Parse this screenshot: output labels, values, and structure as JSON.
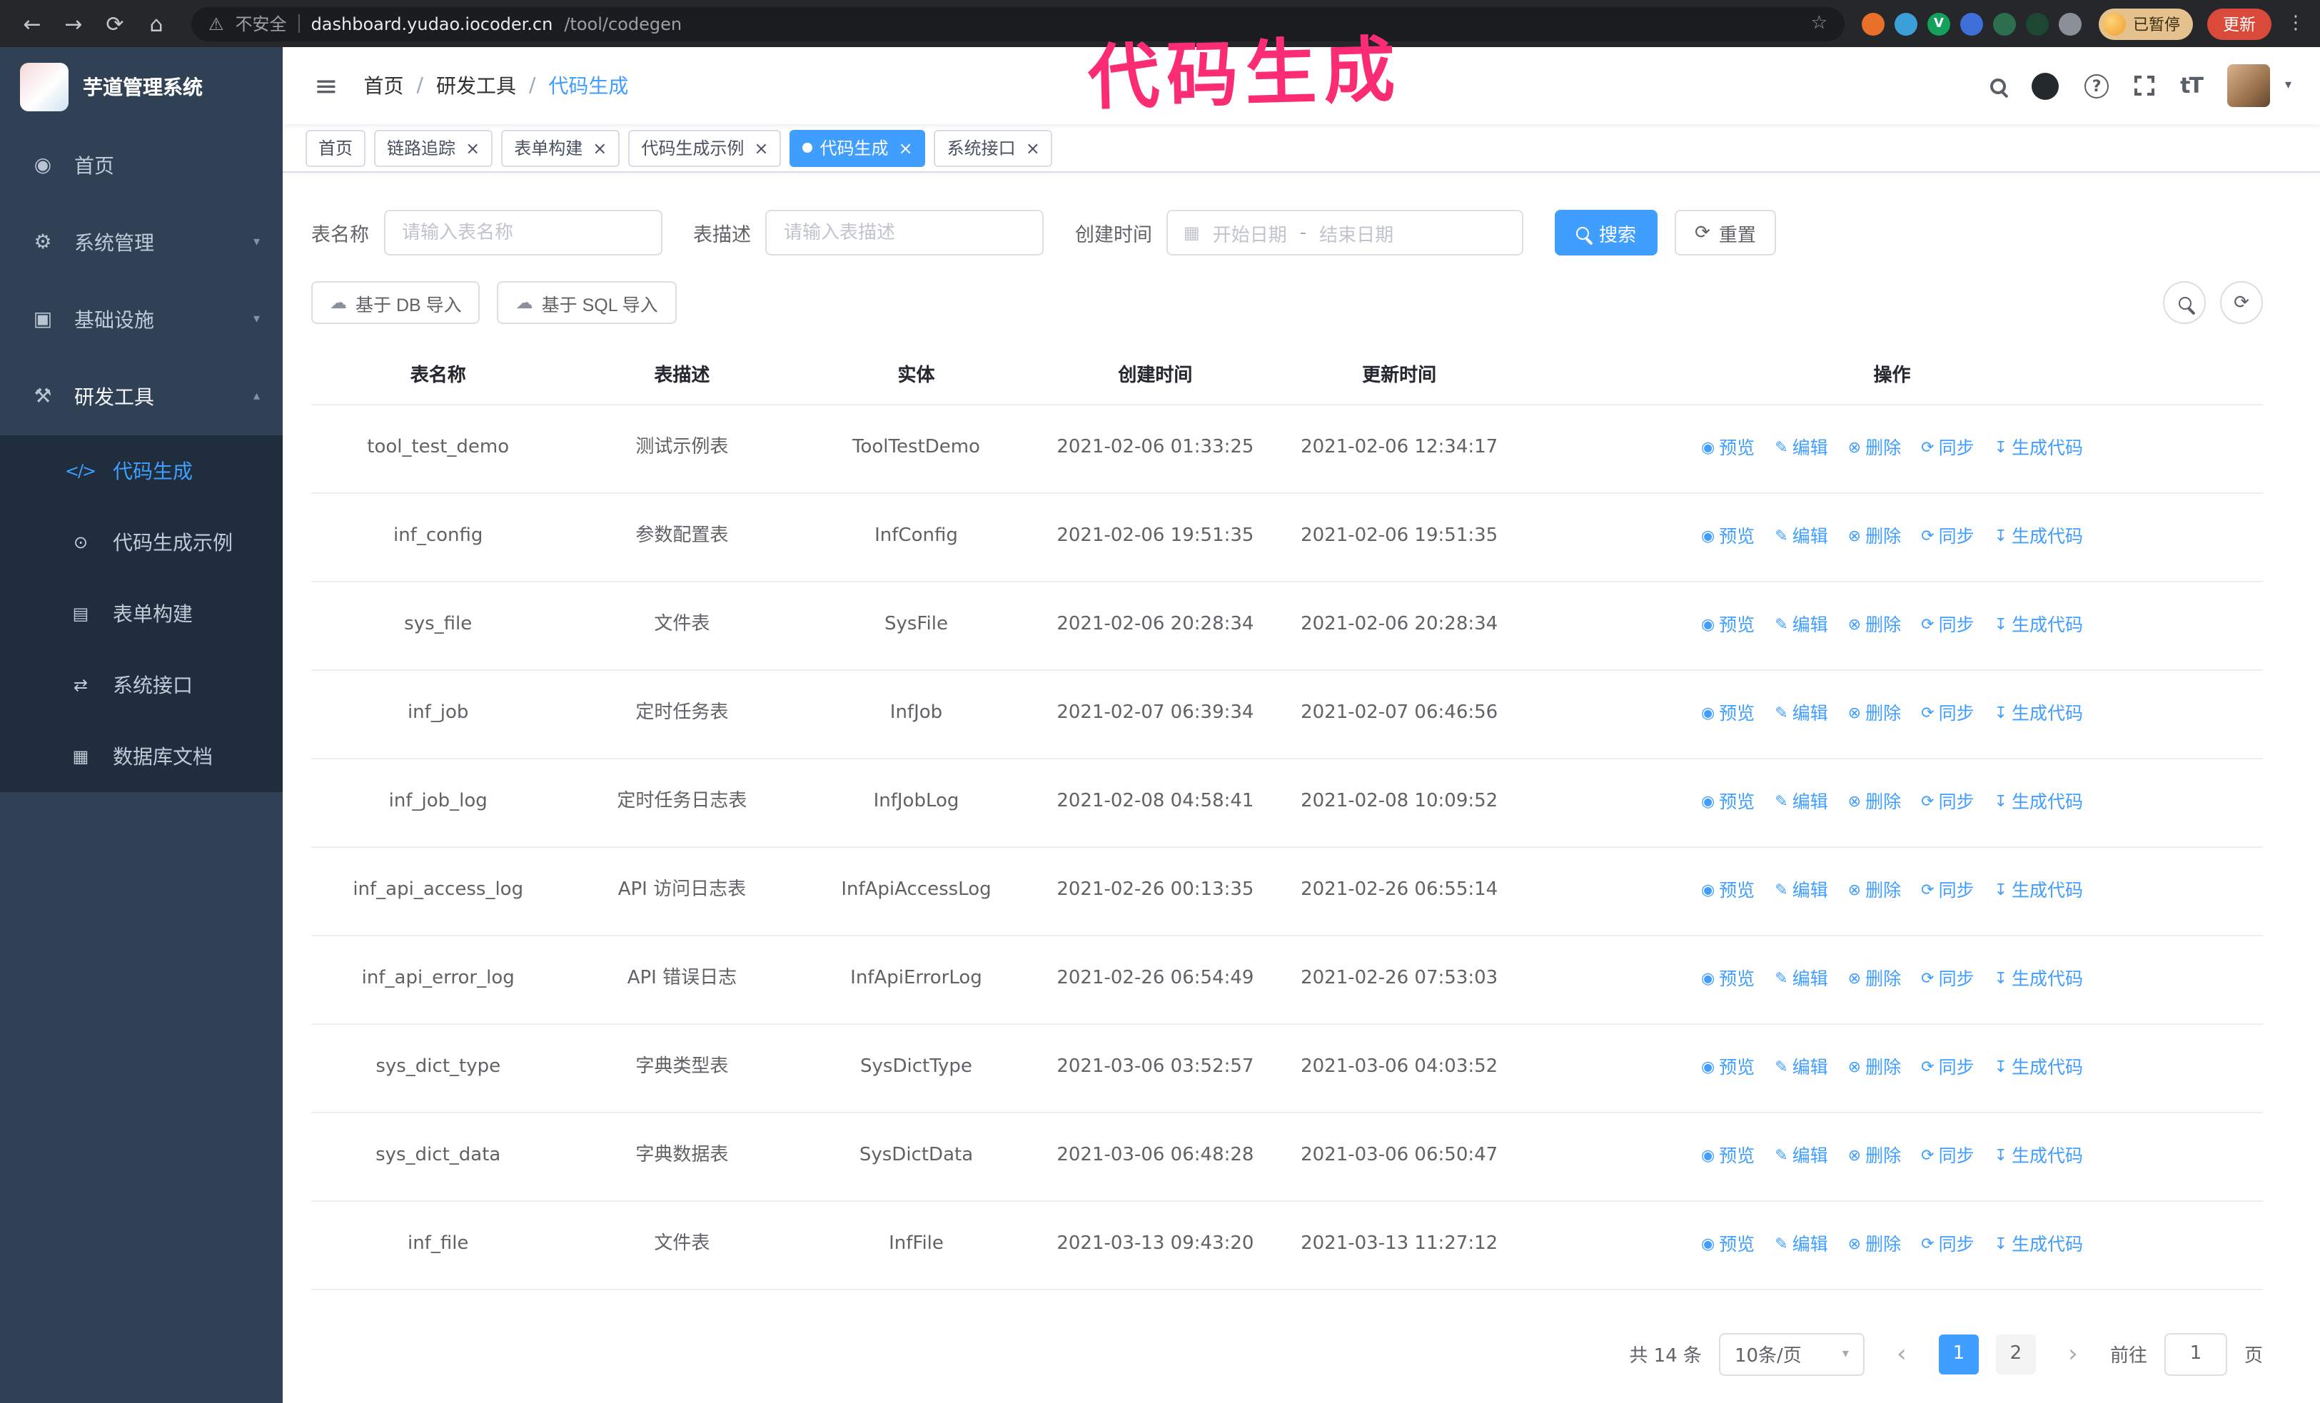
{
  "browser": {
    "security_label": "不安全",
    "url_host": "dashboard.yudao.iocoder.cn",
    "url_path": "/tool/codegen",
    "profile_badge": "已暂停",
    "update_label": "更新",
    "extensions": [
      {
        "name": "extension-icon-orange",
        "color": "#e8702a",
        "glyph": ""
      },
      {
        "name": "extension-icon-lightblue",
        "color": "#3d9fd8",
        "glyph": ""
      },
      {
        "name": "extension-icon-green-v",
        "color": "#16a05d",
        "glyph": "V"
      },
      {
        "name": "extension-icon-blue",
        "color": "#3f6fd8",
        "glyph": ""
      },
      {
        "name": "extension-icon-teal",
        "color": "#2d6e4f",
        "glyph": ""
      },
      {
        "name": "extension-icon-darkgreen",
        "color": "#1d4633",
        "glyph": ""
      },
      {
        "name": "extension-icon-puzzle",
        "color": "#8a8f98",
        "glyph": ""
      }
    ]
  },
  "annotation": {
    "text": "代码生成",
    "color": "#fb2b74"
  },
  "sidebar": {
    "logo_title": "芋道管理系统",
    "menu": [
      {
        "label": "首页"
      },
      {
        "label": "系统管理"
      },
      {
        "label": "基础设施"
      },
      {
        "label": "研发工具"
      }
    ],
    "submenu": [
      {
        "label": "代码生成"
      },
      {
        "label": "代码生成示例"
      },
      {
        "label": "表单构建"
      },
      {
        "label": "系统接口"
      },
      {
        "label": "数据库文档"
      }
    ]
  },
  "breadcrumb": {
    "items": [
      "首页",
      "研发工具",
      "代码生成"
    ],
    "separator": "/"
  },
  "tabs": [
    {
      "label": "首页",
      "closable": false,
      "active": false
    },
    {
      "label": "链路追踪",
      "closable": true,
      "active": false
    },
    {
      "label": "表单构建",
      "closable": true,
      "active": false
    },
    {
      "label": "代码生成示例",
      "closable": true,
      "active": false
    },
    {
      "label": "代码生成",
      "closable": true,
      "active": true
    },
    {
      "label": "系统接口",
      "closable": true,
      "active": false
    }
  ],
  "filters": {
    "table_name_label": "表名称",
    "table_name_placeholder": "请输入表名称",
    "table_desc_label": "表描述",
    "table_desc_placeholder": "请输入表描述",
    "create_time_label": "创建时间",
    "start_placeholder": "开始日期",
    "range_separator": "-",
    "end_placeholder": "结束日期",
    "search_label": "搜索",
    "reset_label": "重置"
  },
  "toolbar": {
    "import_db_label": "基于 DB 导入",
    "import_sql_label": "基于 SQL 导入"
  },
  "table": {
    "columns": [
      "表名称",
      "表描述",
      "实体",
      "创建时间",
      "更新时间",
      "操作"
    ],
    "rows": [
      {
        "name": "tool_test_demo",
        "desc": "测试示例表",
        "entity": "ToolTestDemo",
        "created": "2021-02-06 01:33:25",
        "updated": "2021-02-06 12:34:17"
      },
      {
        "name": "inf_config",
        "desc": "参数配置表",
        "entity": "InfConfig",
        "created": "2021-02-06 19:51:35",
        "updated": "2021-02-06 19:51:35"
      },
      {
        "name": "sys_file",
        "desc": "文件表",
        "entity": "SysFile",
        "created": "2021-02-06 20:28:34",
        "updated": "2021-02-06 20:28:34"
      },
      {
        "name": "inf_job",
        "desc": "定时任务表",
        "entity": "InfJob",
        "created": "2021-02-07 06:39:34",
        "updated": "2021-02-07 06:46:56"
      },
      {
        "name": "inf_job_log",
        "desc": "定时任务日志表",
        "entity": "InfJobLog",
        "created": "2021-02-08 04:58:41",
        "updated": "2021-02-08 10:09:52"
      },
      {
        "name": "inf_api_access_log",
        "desc": "API 访问日志表",
        "entity": "InfApiAccessLog",
        "created": "2021-02-26 00:13:35",
        "updated": "2021-02-26 06:55:14"
      },
      {
        "name": "inf_api_error_log",
        "desc": "API 错误日志",
        "entity": "InfApiErrorLog",
        "created": "2021-02-26 06:54:49",
        "updated": "2021-02-26 07:53:03"
      },
      {
        "name": "sys_dict_type",
        "desc": "字典类型表",
        "entity": "SysDictType",
        "created": "2021-03-06 03:52:57",
        "updated": "2021-03-06 04:03:52"
      },
      {
        "name": "sys_dict_data",
        "desc": "字典数据表",
        "entity": "SysDictData",
        "created": "2021-03-06 06:48:28",
        "updated": "2021-03-06 06:50:47"
      },
      {
        "name": "inf_file",
        "desc": "文件表",
        "entity": "InfFile",
        "created": "2021-03-13 09:43:20",
        "updated": "2021-03-13 11:27:12"
      }
    ],
    "actions": [
      {
        "key": "preview",
        "label": "预览",
        "icon": "◉"
      },
      {
        "key": "edit",
        "label": "编辑",
        "icon": "✎"
      },
      {
        "key": "delete",
        "label": "删除",
        "icon": "⊗"
      },
      {
        "key": "sync",
        "label": "同步",
        "icon": "⟳"
      },
      {
        "key": "generate",
        "label": "生成代码",
        "icon": "↧"
      }
    ]
  },
  "pagination": {
    "total_text": "共 14 条",
    "page_size_text": "10条/页",
    "pages": [
      "1",
      "2"
    ],
    "active_page": "1",
    "goto_label": "前往",
    "goto_value": "1",
    "goto_suffix": "页"
  },
  "colors": {
    "accent": "#409eff",
    "sidebar_bg": "#304156",
    "submenu_bg": "#1f2d3d",
    "update_button_bg": "#d94a3a",
    "profile_chip_bg": "#e5c28d"
  },
  "icons": {
    "back": "←",
    "forward": "→",
    "reload": "⟳",
    "home": "⌂",
    "warning": "⚠",
    "star": "☆",
    "kebab": "⋮",
    "hamburger": "≡",
    "chevron_down": "▾",
    "chevron_up": "▴",
    "close": "×",
    "calendar": "▦",
    "refresh": "⟳",
    "question": "?",
    "caret_down": "▾",
    "font_size": "tT",
    "menu_home": "◉",
    "menu_system": "⚙",
    "menu_infra": "▣",
    "menu_tool": "⚒",
    "sub_code": "</>",
    "sub_example": "⊙",
    "sub_form": "▤",
    "sub_api": "⇄",
    "sub_db": "▦",
    "upload": "☁",
    "prev": "‹",
    "next": "›"
  }
}
